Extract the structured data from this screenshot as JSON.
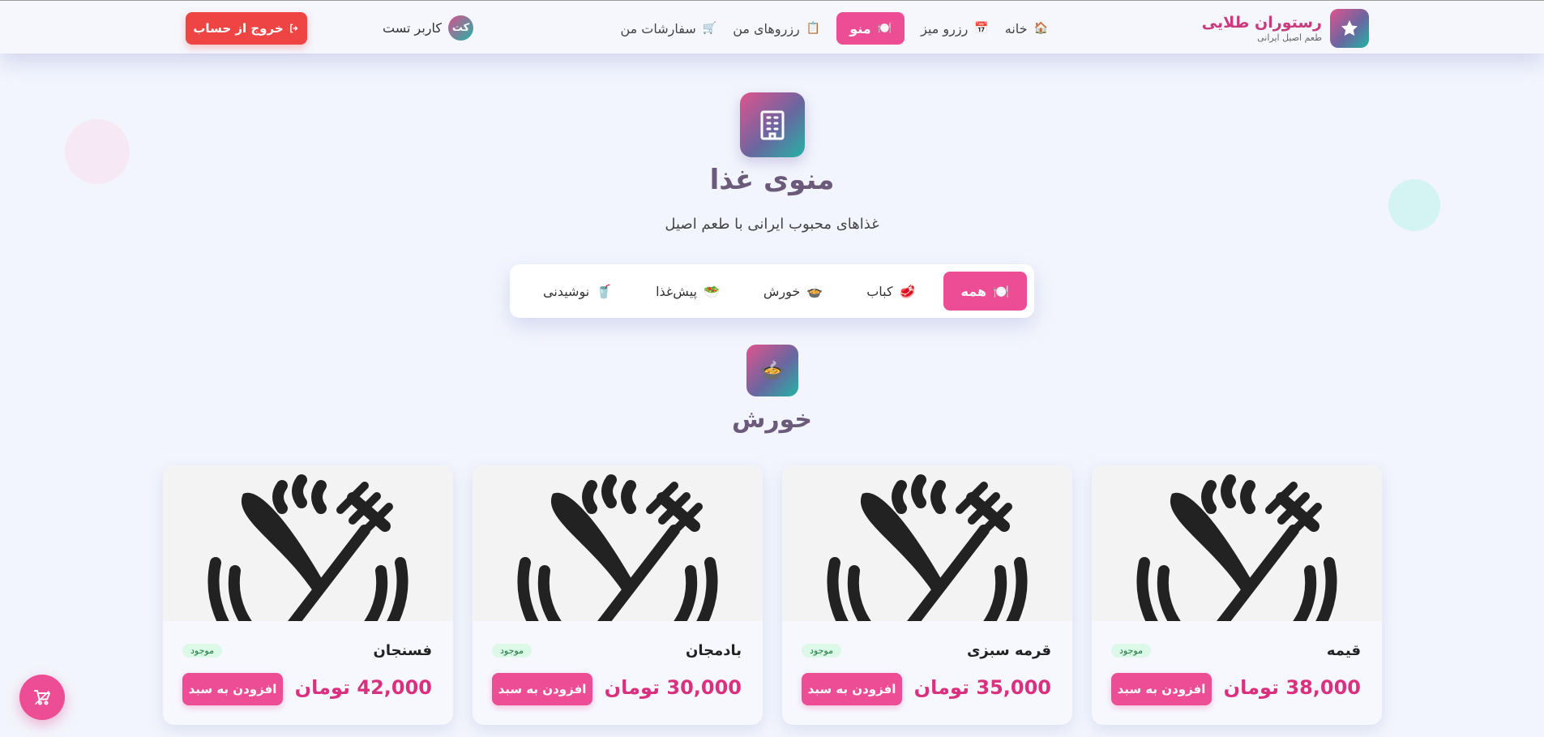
{
  "brand": {
    "title": "رستوران طلایی",
    "subtitle": "طعم اصیل ایرانی",
    "logo_icon": "star-icon"
  },
  "nav": {
    "items": [
      {
        "label": "خانه",
        "icon": "house-icon",
        "glyph": "🏠",
        "active": false
      },
      {
        "label": "رزرو میز",
        "icon": "calendar-icon",
        "glyph": "📅",
        "active": false
      },
      {
        "label": "منو",
        "icon": "plate-icon",
        "glyph": "🍽️",
        "active": true
      },
      {
        "label": "رزروهای من",
        "icon": "clipboard-icon",
        "glyph": "📋",
        "active": false
      },
      {
        "label": "سفارشات من",
        "icon": "cart-icon",
        "glyph": "🛒",
        "active": false
      }
    ]
  },
  "user": {
    "initials": "کت",
    "name": "کاربر تست",
    "logout_label": "خروج از حساب"
  },
  "hero": {
    "title": "منوی غذا",
    "subtitle": "غذاهای محبوب ایرانی با طعم اصیل",
    "icon": "building-icon"
  },
  "filters": [
    {
      "label": "همه",
      "glyph": "🍽️",
      "active": true
    },
    {
      "label": "کباب",
      "glyph": "🥩",
      "active": false
    },
    {
      "label": "خورش",
      "glyph": "🍲",
      "active": false
    },
    {
      "label": "پیش‌غذا",
      "glyph": "🥗",
      "active": false
    },
    {
      "label": "نوشیدنی",
      "glyph": "🥤",
      "active": false
    }
  ],
  "section": {
    "title": "خورش",
    "glyph": "🍲"
  },
  "dishes": [
    {
      "name": "قیمه",
      "price": "38,000 تومان",
      "status": "موجود",
      "button": "افزودن به سبد"
    },
    {
      "name": "قرمه سبزی",
      "price": "35,000 تومان",
      "status": "موجود",
      "button": "افزودن به سبد"
    },
    {
      "name": "بادمجان",
      "price": "30,000 تومان",
      "status": "موجود",
      "button": "افزودن به سبد"
    },
    {
      "name": "فسنجان",
      "price": "42,000 تومان",
      "status": "موجود",
      "button": "افزودن به سبد"
    }
  ],
  "colors": {
    "accent": "#ec4d94",
    "logout": "#ef4444",
    "price": "#d9317f",
    "title": "#6b5a7a"
  }
}
